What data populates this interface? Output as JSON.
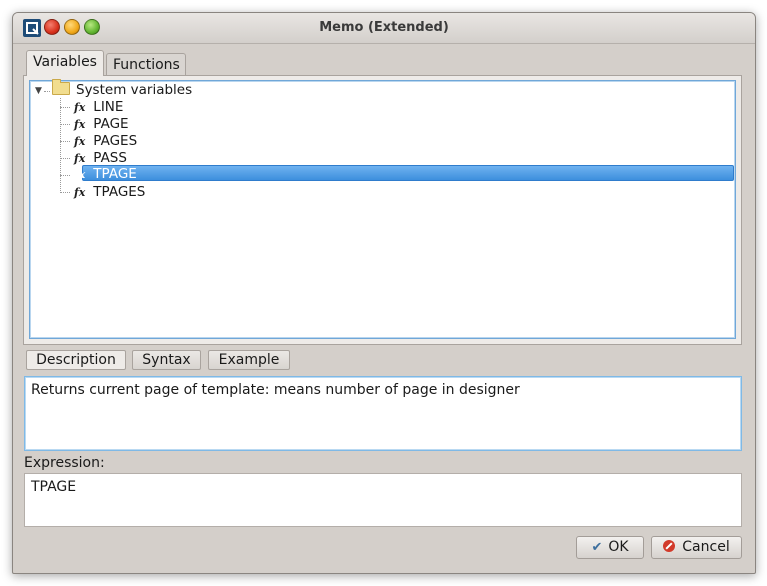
{
  "window": {
    "title": "Memo (Extended)"
  },
  "tabs": {
    "variables": "Variables",
    "functions": "Functions"
  },
  "tree": {
    "root_label": "System variables",
    "items": [
      {
        "label": "LINE",
        "icon": "function-icon"
      },
      {
        "label": "PAGE",
        "icon": "function-icon"
      },
      {
        "label": "PAGES",
        "icon": "function-icon"
      },
      {
        "label": "PASS",
        "icon": "function-icon"
      },
      {
        "label": "TPAGE",
        "icon": "function-icon",
        "selected": true
      },
      {
        "label": "TPAGES",
        "icon": "function-icon"
      }
    ],
    "fx_glyph": "fx"
  },
  "info_tabs": {
    "description": "Description",
    "syntax": "Syntax",
    "example": "Example"
  },
  "description_text": "Returns current page of template: means number of page in designer",
  "expression": {
    "label": "Expression:",
    "value": "TPAGE"
  },
  "buttons": {
    "ok": "OK",
    "cancel": "Cancel"
  },
  "colors": {
    "selection": "#3d8fdd",
    "accent_border": "#7fb9e6",
    "window_bg": "#d4cfca"
  }
}
